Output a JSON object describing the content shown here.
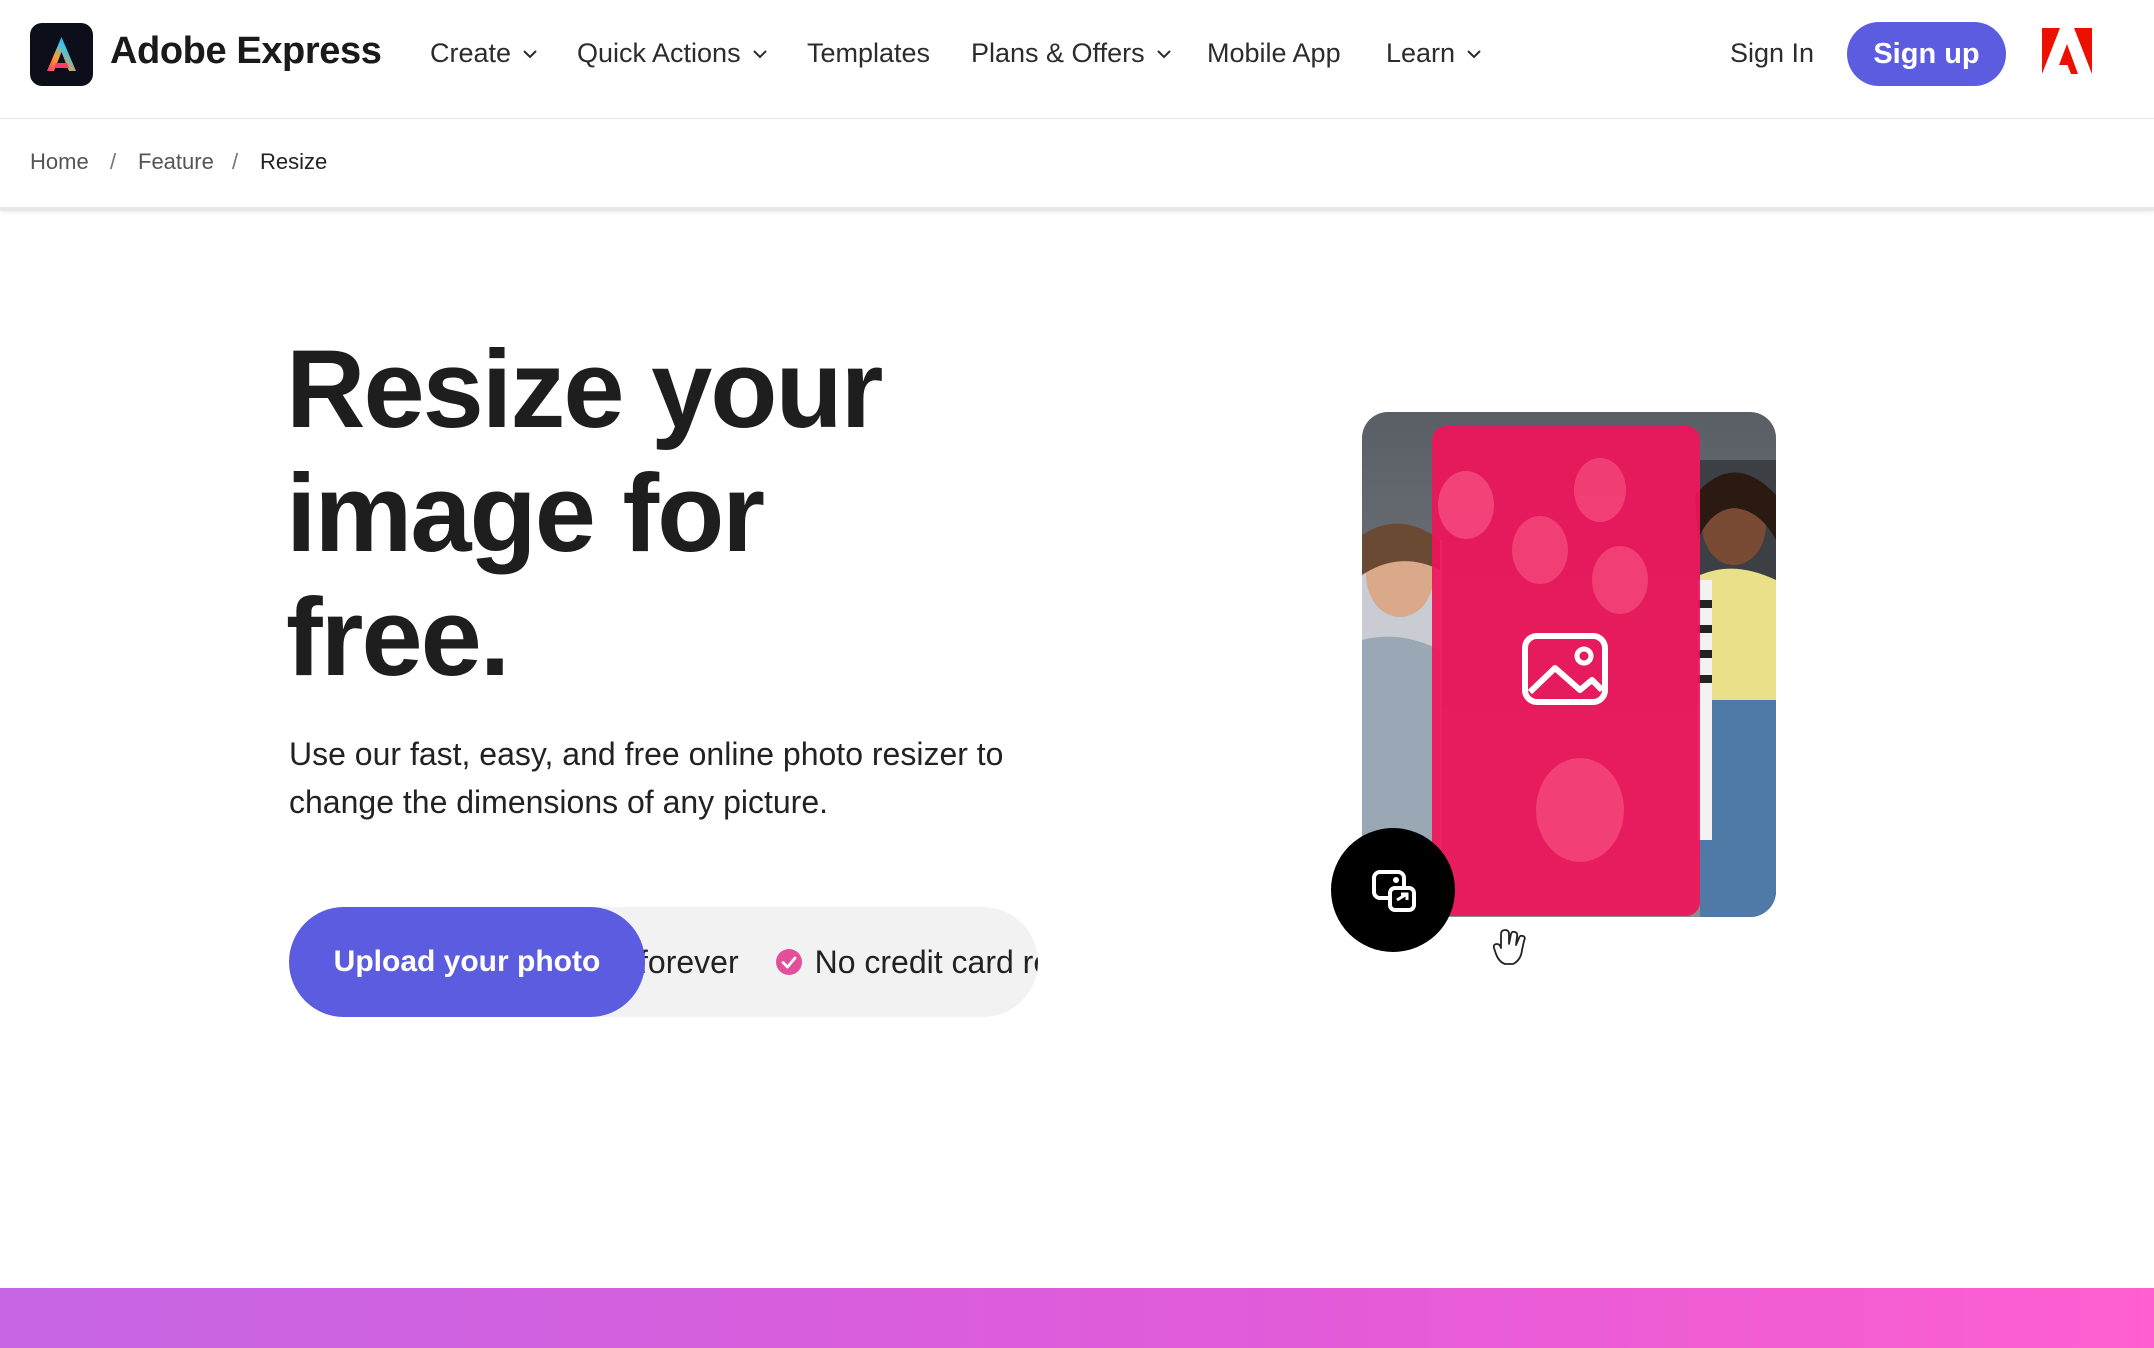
{
  "header": {
    "brand": "Adobe Express",
    "nav": [
      {
        "label": "Create",
        "has_menu": true
      },
      {
        "label": "Quick Actions",
        "has_menu": true
      },
      {
        "label": "Templates",
        "has_menu": false
      },
      {
        "label": "Plans & Offers",
        "has_menu": true
      },
      {
        "label": "Mobile App",
        "has_menu": false
      },
      {
        "label": "Learn",
        "has_menu": true
      }
    ],
    "sign_in": "Sign In",
    "sign_up": "Sign up"
  },
  "breadcrumb": [
    "Home",
    "Feature",
    "Resize"
  ],
  "hero": {
    "title": "Resize your image for free.",
    "subtitle": "Use our fast, easy, and free online photo resizer to change the dimensions of any picture.",
    "cta": "Upload your photo",
    "features": [
      "forever",
      "No credit card rec"
    ]
  },
  "colors": {
    "accent": "#5c5ce0",
    "overlay_pink": "#f0145a",
    "check_pink": "#e34f9b",
    "band_start": "#c565e4",
    "band_end": "#ff5fd0"
  },
  "icons": {
    "image_placeholder": "image-icon",
    "resize_badge": "resize-image-icon",
    "cursor": "hand-cursor-icon",
    "adobe": "adobe-logo-icon"
  }
}
